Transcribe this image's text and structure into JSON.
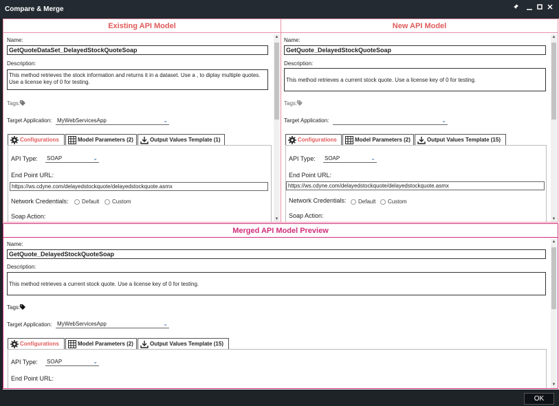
{
  "window": {
    "title": "Compare & Merge"
  },
  "existing": {
    "header": "Existing API Model",
    "name_label": "Name:",
    "name": "GetQuoteDataSet_DelayedStockQuoteSoap",
    "description_label": "Description:",
    "description": "This method retrieves the stock information and returns it in a dataset.  Use a , to diplay multiple quotes.  Use a license key of 0 for testing.",
    "tags_label": "Tags:",
    "target_label": "Target Application:",
    "target_value": "MyWebServicesApp",
    "tabs": [
      "Configurations",
      "Model Parameters (2)",
      "Output Values Template (1)"
    ],
    "api_type_label": "API Type:",
    "api_type": "SOAP",
    "endpoint_label": "End Point URL:",
    "endpoint": "https://ws.cdyne.com/delayedstockquote/delayedstockquote.asmx",
    "net_cred_label": "Network Credentials:",
    "cred_default": "Default",
    "cred_custom": "Custom",
    "soap_action_label": "Soap Action:"
  },
  "new": {
    "header": "New API Model",
    "name_label": "Name:",
    "name": "GetQuote_DelayedStockQuoteSoap",
    "description_label": "Description:",
    "description": "This method retrieves a current stock quote.  Use a license key of 0 for testing.",
    "tags_label": "Tags:",
    "target_label": "Target Application:",
    "target_value": "",
    "tabs": [
      "Configurations",
      "Model Parameters (2)",
      "Output Values Template (15)"
    ],
    "api_type_label": "API Type:",
    "api_type": "SOAP",
    "endpoint_label": "End Point URL:",
    "endpoint": "https://ws.cdyne.com/delayedstockquote/delayedstockquote.asmx",
    "net_cred_label": "Network Credentials:",
    "cred_default": "Default",
    "cred_custom": "Custom",
    "soap_action_label": "Soap Action:"
  },
  "merged": {
    "header": "Merged API Model Preview",
    "name_label": "Name:",
    "name": "GetQuote_DelayedStockQuoteSoap",
    "description_label": "Description:",
    "description": "This method retrieves a current stock quote.  Use a license key of 0 for testing.",
    "tags_label": "Tags:",
    "target_label": "Target Application:",
    "target_value": "MyWebServicesApp",
    "tabs": [
      "Configurations",
      "Model Parameters (2)",
      "Output Values Template (15)"
    ],
    "api_type_label": "API Type:",
    "api_type": "SOAP",
    "endpoint_label": "End Point URL:"
  },
  "footer": {
    "ok_label": "OK"
  },
  "colors": {
    "accent": "#e05a5a",
    "merged_accent": "#d02e79",
    "titlebar": "#232a31"
  },
  "icons": [
    "pin-icon",
    "minimize-icon",
    "maximize-icon",
    "close-icon",
    "gear-icon",
    "grid-icon",
    "download-icon",
    "tag-icon",
    "chevron-down-icon"
  ]
}
